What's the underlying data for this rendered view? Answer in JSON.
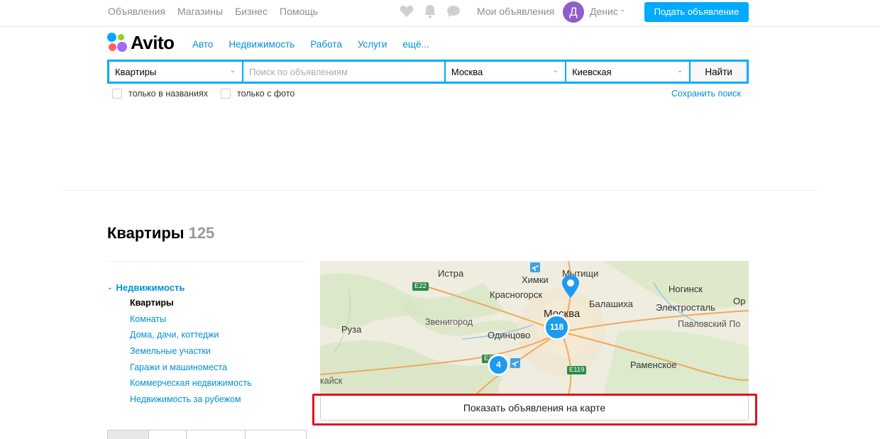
{
  "top_nav": {
    "links": [
      "Объявления",
      "Магазины",
      "Бизнес",
      "Помощь"
    ],
    "icons": [
      "heart-icon",
      "bell-icon",
      "chat-icon"
    ],
    "my_ads": "Мои объявления",
    "user_initial": "Д",
    "user_name": "Денис",
    "post_button": "Подать объявление"
  },
  "logo": {
    "text": "Avito",
    "dot_colors": [
      "#00aaff",
      "#97cf26",
      "#ff6163",
      "#a169f7"
    ]
  },
  "category_nav": [
    "Авто",
    "Недвижимость",
    "Работа",
    "Услуги",
    "ещё..."
  ],
  "search": {
    "category_value": "Квартиры",
    "query_placeholder": "Поиск по объявлениям",
    "city_value": "Москва",
    "metro_value": "Киевская",
    "submit_label": "Найти"
  },
  "filters": {
    "titles_only": "только в названиях",
    "with_photo": "только с фото",
    "save_search": "Сохранить поиск"
  },
  "page": {
    "title": "Квартиры",
    "count": "125"
  },
  "sidebar": {
    "root": "Недвижимость",
    "items": [
      {
        "label": "Квартиры",
        "active": true
      },
      {
        "label": "Комнаты",
        "active": false
      },
      {
        "label": "Дома, дачи, коттеджи",
        "active": false
      },
      {
        "label": "Земельные участки",
        "active": false
      },
      {
        "label": "Гаражи и машиноместа",
        "active": false
      },
      {
        "label": "Коммерческая недвижимость",
        "active": false
      },
      {
        "label": "Недвижимость за рубежом",
        "active": false
      }
    ]
  },
  "map": {
    "places": {
      "istra": "Истра",
      "khimki": "Химки",
      "mytishchi": "Мытищи",
      "krasnogorsk": "Красногорск",
      "noginsk": "Ногинск",
      "moscow": "Москва",
      "balashikha": "Балашиха",
      "elektrostal": "Электросталь",
      "or": "Ор",
      "zvenigorod": "Звенигород",
      "pavlovsky": "Павловский По",
      "ruza": "Руза",
      "odintsovo": "Одинцово",
      "ramenskoe": "Раменское",
      "kaysk": "кайск"
    },
    "roads": {
      "e22": "E22",
      "e119": "E119",
      "e30": "E30"
    },
    "clusters": {
      "big": "118",
      "small": "4"
    },
    "show_on_map": "Показать объявления на карте"
  },
  "accent_colors": {
    "link": "#0091d9",
    "primary": "#00aaff",
    "highlight": "#e0131d"
  }
}
